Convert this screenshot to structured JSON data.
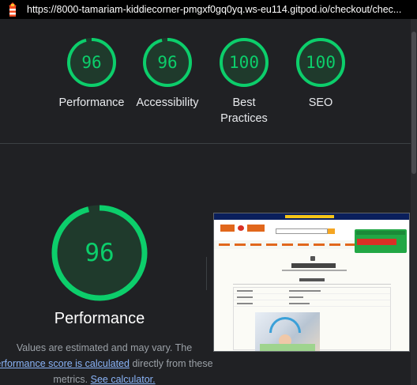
{
  "topbar": {
    "url": "https://8000-tamariam-kiddiecorner-pmgxf0gq0yq.ws-eu114.gitpod.io/checkout/chec..."
  },
  "gauges": [
    {
      "score": "96",
      "label": "Performance",
      "value": 96
    },
    {
      "score": "96",
      "label": "Accessibility",
      "value": 96
    },
    {
      "score": "100",
      "label": "Best Practices",
      "value": 100
    },
    {
      "score": "100",
      "label": "SEO",
      "value": 100
    }
  ],
  "detail": {
    "score": "96",
    "value": 96,
    "title": "Performance",
    "note_start": "Values are estimated and may vary. The",
    "note_link": "erformance score is calculated",
    "note_mid": "directly from these",
    "note_end": "metrics.",
    "calc_link": "See calculator."
  },
  "colors": {
    "pass": "#0cce6b",
    "background": "#202124",
    "link": "#8ab4f8"
  }
}
